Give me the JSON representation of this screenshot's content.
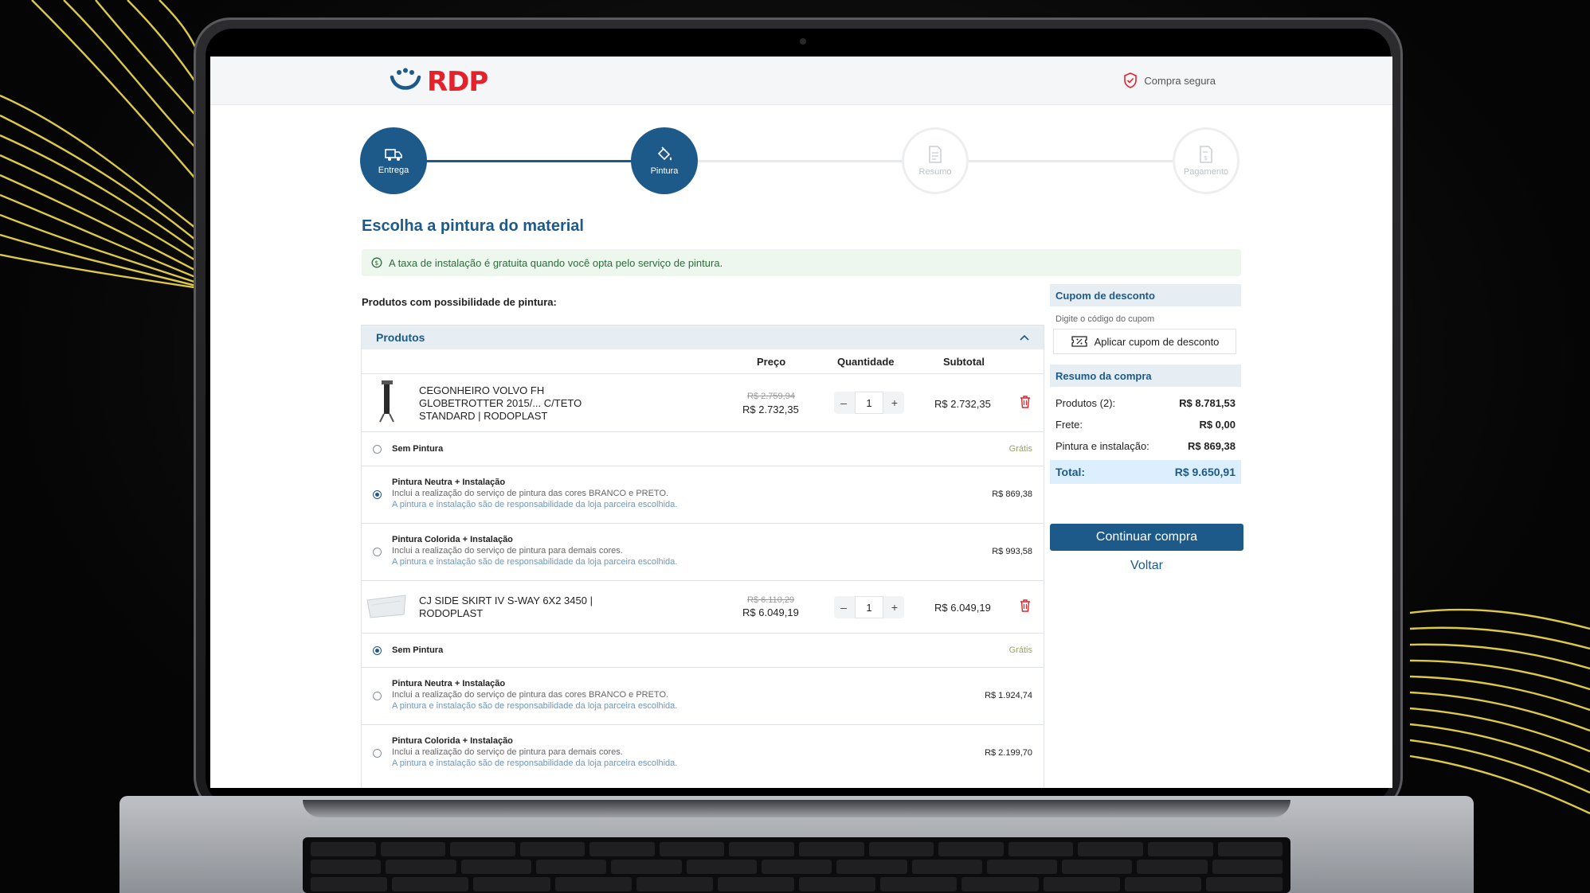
{
  "header": {
    "logo_text": "RDP",
    "secure_label": "Compra segura"
  },
  "steps": [
    {
      "label": "Entrega",
      "state": "active",
      "icon": "truck-icon"
    },
    {
      "label": "Pintura",
      "state": "active",
      "icon": "paint-bucket-icon"
    },
    {
      "label": "Resumo",
      "state": "inactive",
      "icon": "document-icon"
    },
    {
      "label": "Pagamento",
      "state": "inactive",
      "icon": "payment-document-icon"
    }
  ],
  "page": {
    "title": "Escolha a pintura do material",
    "notice": "A taxa de instalação é gratuita quando você opta pelo serviço de pintura.",
    "section_label": "Produtos com possibilidade de pintura:"
  },
  "table": {
    "header": "Produtos",
    "col_price": "Preço",
    "col_qty": "Quantidade",
    "col_subtotal": "Subtotal",
    "products": [
      {
        "name": "CEGONHEIRO VOLVO FH GLOBETROTTER 2015/... C/TETO STANDARD | RODOPLAST",
        "price_old": "R$ 2.759,94",
        "price_new": "R$ 2.732,35",
        "qty": "1",
        "subtotal": "R$ 2.732,35",
        "options": [
          {
            "title": "Sem Pintura",
            "desc": "",
            "note": "",
            "price": "Grátis",
            "checked": false
          },
          {
            "title": "Pintura Neutra + Instalação",
            "desc": "Inclui a realização do serviço de pintura das cores BRANCO e PRETO.",
            "note": "A pintura e instalação são de responsabilidade da loja parceira escolhida.",
            "price": "R$ 869,38",
            "checked": true
          },
          {
            "title": "Pintura Colorida + Instalação",
            "desc": "Inclui a realização do serviço de pintura para demais cores.",
            "note": "A pintura e instalação são de responsabilidade da loja parceira escolhida.",
            "price": "R$ 993,58",
            "checked": false
          }
        ]
      },
      {
        "name": "CJ SIDE SKIRT IV S-WAY 6X2 3450 | RODOPLAST",
        "price_old": "R$ 6.110,29",
        "price_new": "R$ 6.049,19",
        "qty": "1",
        "subtotal": "R$ 6.049,19",
        "options": [
          {
            "title": "Sem Pintura",
            "desc": "",
            "note": "",
            "price": "Grátis",
            "checked": true
          },
          {
            "title": "Pintura Neutra + Instalação",
            "desc": "Inclui a realização do serviço de pintura das cores BRANCO e PRETO.",
            "note": "A pintura e instalação são de responsabilidade da loja parceira escolhida.",
            "price": "R$ 1.924,74",
            "checked": false
          },
          {
            "title": "Pintura Colorida + Instalação",
            "desc": "Inclui a realização do serviço de pintura para demais cores.",
            "note": "A pintura e instalação são de responsabilidade da loja parceira escolhida.",
            "price": "R$ 2.199,70",
            "checked": false
          }
        ]
      }
    ]
  },
  "sidebar": {
    "coupon_title": "Cupom de desconto",
    "coupon_label": "Digite o código do cupom",
    "coupon_button": "Aplicar cupom de desconto",
    "summary_title": "Resumo da compra",
    "rows": [
      {
        "label": "Produtos (2):",
        "value": "R$ 8.781,53"
      },
      {
        "label": "Frete:",
        "value": "R$ 0,00"
      },
      {
        "label": "Pintura e instalação:",
        "value": "R$ 869,38"
      }
    ],
    "total_label": "Total:",
    "total_value": "R$ 9.650,91",
    "continue_label": "Continuar compra",
    "back_label": "Voltar"
  },
  "colors": {
    "brand_red": "#e4222b",
    "primary_blue": "#1d5a8a",
    "accent_yellow": "#f4e04d"
  }
}
